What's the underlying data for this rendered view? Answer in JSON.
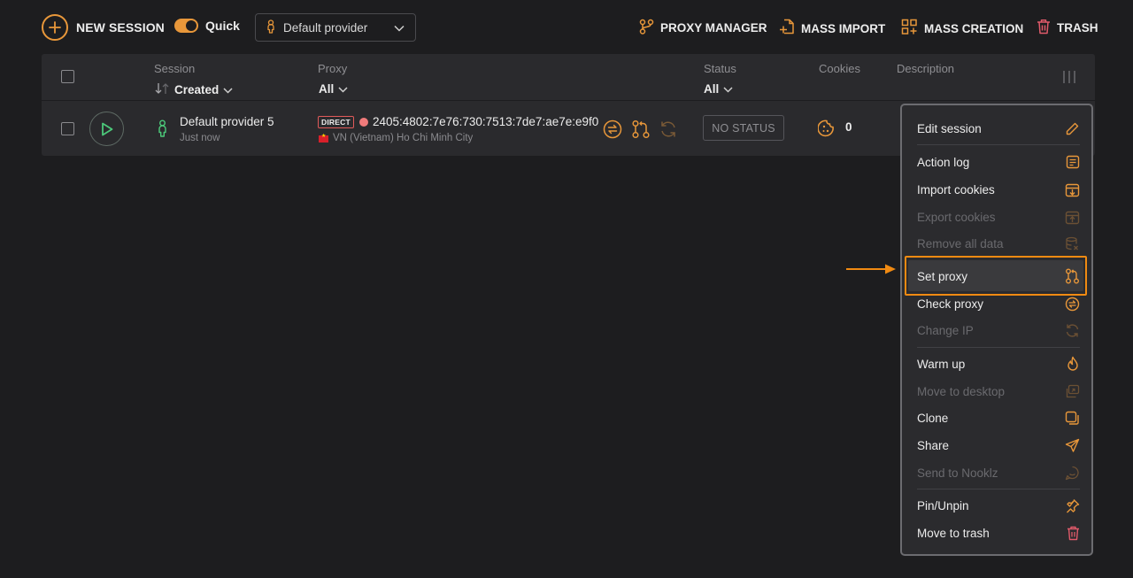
{
  "toolbar": {
    "new_session": "NEW SESSION",
    "quick_label": "Quick",
    "quick_enabled": true,
    "provider": "Default provider",
    "proxy_manager": "PROXY MANAGER",
    "mass_import": "MASS IMPORT",
    "mass_creation": "MASS CREATION",
    "trash": "TRASH"
  },
  "table": {
    "headers": {
      "session": "Session",
      "session_sort": "Created",
      "proxy": "Proxy",
      "proxy_filter": "All",
      "status": "Status",
      "status_filter": "All",
      "cookies": "Cookies",
      "description": "Description"
    },
    "rows": [
      {
        "name": "Default provider 5",
        "created": "Just now",
        "proxy_type": "DIRECT",
        "proxy_ip": "2405:4802:7e76:730:7513:7de7:ae7e:e9f0",
        "proxy_location": "VN (Vietnam) Ho Chi Minh City",
        "status": "NO STATUS",
        "cookies": "0"
      }
    ]
  },
  "context_menu": {
    "items": [
      {
        "label": "Edit session",
        "icon": "pencil-icon",
        "enabled": true
      },
      {
        "label": "Action log",
        "icon": "log-icon",
        "enabled": true
      },
      {
        "label": "Import cookies",
        "icon": "import-box-icon",
        "enabled": true
      },
      {
        "label": "Export cookies",
        "icon": "export-box-icon",
        "enabled": false
      },
      {
        "label": "Remove all data",
        "icon": "database-remove-icon",
        "enabled": false
      },
      {
        "label": "Set proxy",
        "icon": "proxy-route-icon",
        "enabled": true,
        "highlighted": true
      },
      {
        "label": "Check proxy",
        "icon": "swap-circle-icon",
        "enabled": true
      },
      {
        "label": "Change IP",
        "icon": "refresh-icon",
        "enabled": false
      },
      {
        "label": "Warm up",
        "icon": "flame-icon",
        "enabled": true
      },
      {
        "label": "Move to desktop",
        "icon": "desktop-copy-icon",
        "enabled": false
      },
      {
        "label": "Clone",
        "icon": "clone-icon",
        "enabled": true
      },
      {
        "label": "Share",
        "icon": "send-icon",
        "enabled": true
      },
      {
        "label": "Send to Nooklz",
        "icon": "nooklz-icon",
        "enabled": false
      },
      {
        "label": "Pin/Unpin",
        "icon": "pin-icon",
        "enabled": true
      },
      {
        "label": "Move to trash",
        "icon": "trash-icon",
        "enabled": true
      }
    ]
  },
  "colors": {
    "accent": "#e8973a",
    "highlight": "#f08a12",
    "background": "#1d1d1f",
    "table_bg": "#2a2a2d",
    "status_red": "#e05a5a",
    "session_green": "#4cc97a"
  }
}
